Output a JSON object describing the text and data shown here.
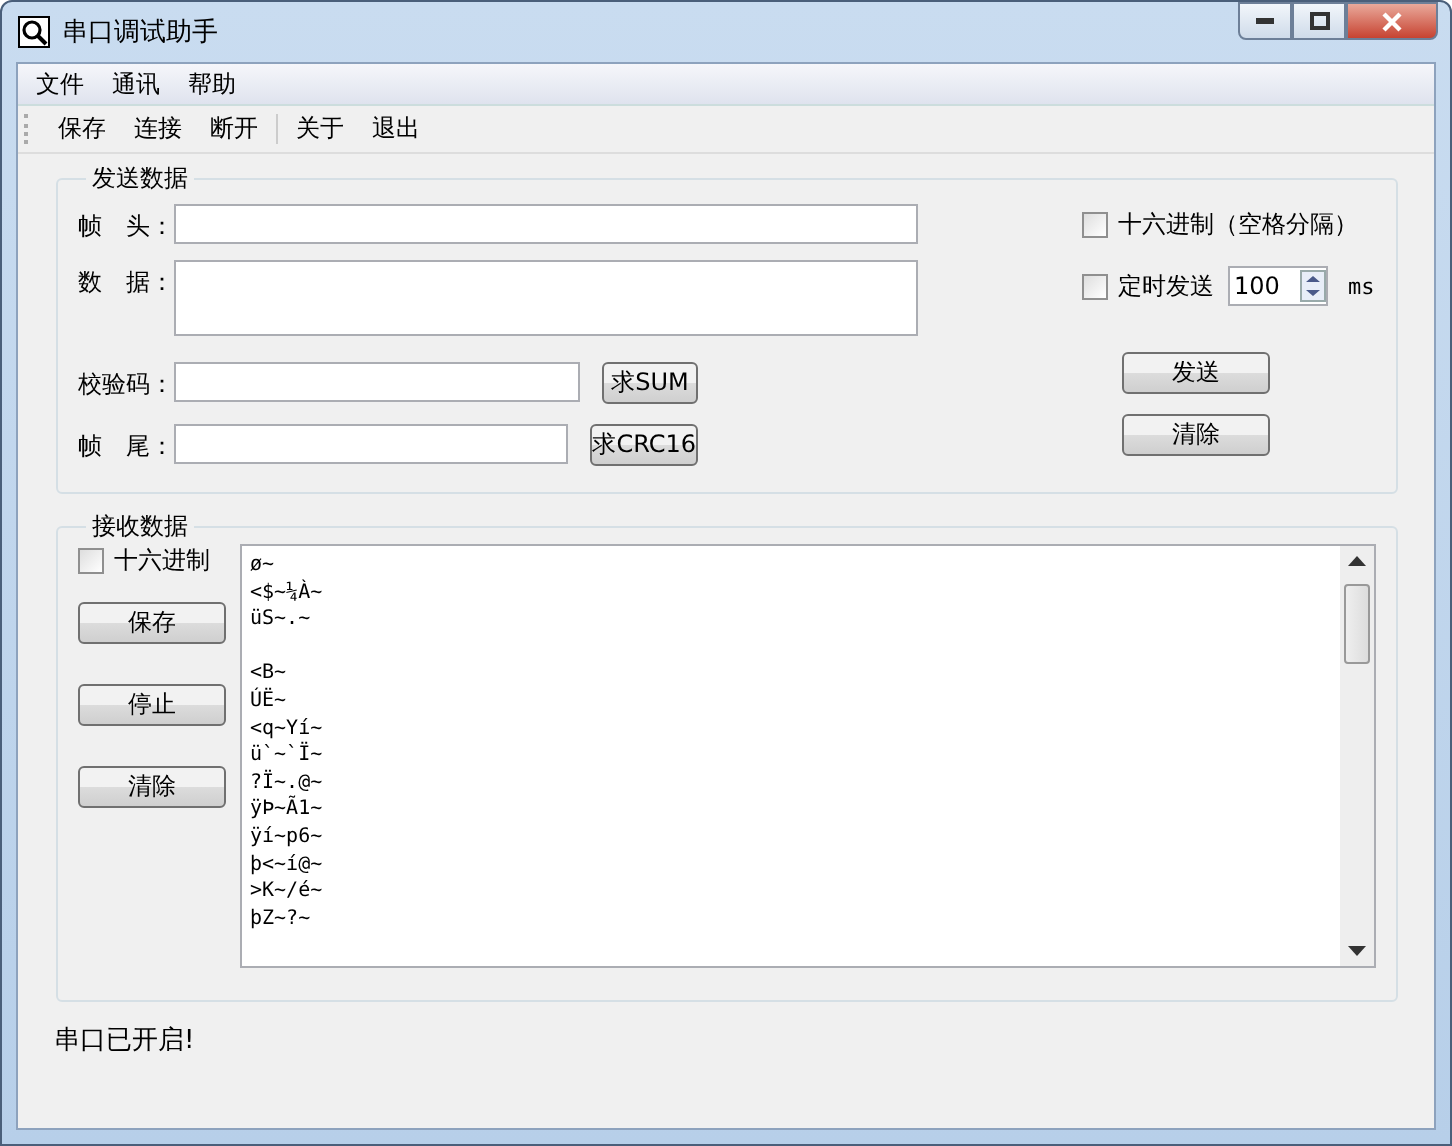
{
  "window": {
    "title": "串口调试助手"
  },
  "menu": [
    {
      "label": "文件"
    },
    {
      "label": "通讯"
    },
    {
      "label": "帮助"
    }
  ],
  "toolbar": [
    [
      {
        "label": "保存"
      },
      {
        "label": "连接"
      },
      {
        "label": "断开"
      }
    ],
    [
      {
        "label": "关于"
      },
      {
        "label": "退出"
      }
    ]
  ],
  "send": {
    "title": "发送数据",
    "fields": [
      {
        "label": "帧　头：",
        "kind": "line"
      },
      {
        "label": "数　据：",
        "kind": "area"
      },
      {
        "label": "校验码：",
        "kind": "short",
        "button": "求SUM"
      },
      {
        "label": "帧　尾：",
        "kind": "short",
        "button": "求CRC16"
      }
    ],
    "hex": {
      "label": "十六进制（空格分隔）",
      "checked": false
    },
    "timer": {
      "label": "定时发送",
      "checked": false,
      "interval": "100",
      "unit": "ms"
    },
    "buttons": [
      "发送",
      "清除"
    ]
  },
  "receive": {
    "title": "接收数据",
    "hex": {
      "label": "十六进制",
      "checked": false
    },
    "buttons": [
      "保存",
      "停止",
      "清除"
    ],
    "blocks": [
      [
        "ø~",
        "<$~¼À~",
        "üS~.~"
      ],
      [
        "<B~",
        "ÚË~",
        "<q~Yí~",
        "ü`~`Ï~",
        "?Ï~.@~",
        "ÿÞ~Ã1~",
        "ÿí~p6~",
        "þ<~í@~",
        ">K~/é~",
        "þZ~?~"
      ]
    ]
  },
  "status": "串口已开启!"
}
